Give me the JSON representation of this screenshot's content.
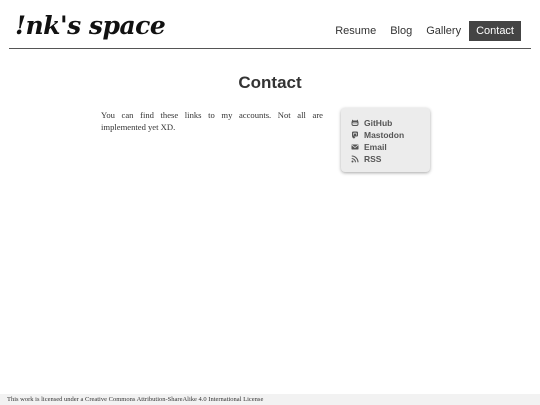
{
  "site": {
    "title": "!nk's space"
  },
  "nav": {
    "items": [
      {
        "label": "Resume"
      },
      {
        "label": "Blog"
      },
      {
        "label": "Gallery"
      },
      {
        "label": "Contact",
        "active": true
      }
    ]
  },
  "page": {
    "title": "Contact",
    "intro": "You can find these links to my accounts. Not all are implemented yet XD."
  },
  "links": [
    {
      "label": "GitHub",
      "icon": "github-icon"
    },
    {
      "label": "Mastodon",
      "icon": "mastodon-icon"
    },
    {
      "label": "Email",
      "icon": "email-icon"
    },
    {
      "label": "RSS",
      "icon": "rss-icon"
    }
  ],
  "footer": {
    "text": "This work is licensed under a Creative Commons Attribution-ShareAlike 4.0 International License"
  },
  "colors": {
    "nav_active_bg": "#444444",
    "card_bg": "#ececec",
    "footer_bg": "#f2f2f2"
  }
}
